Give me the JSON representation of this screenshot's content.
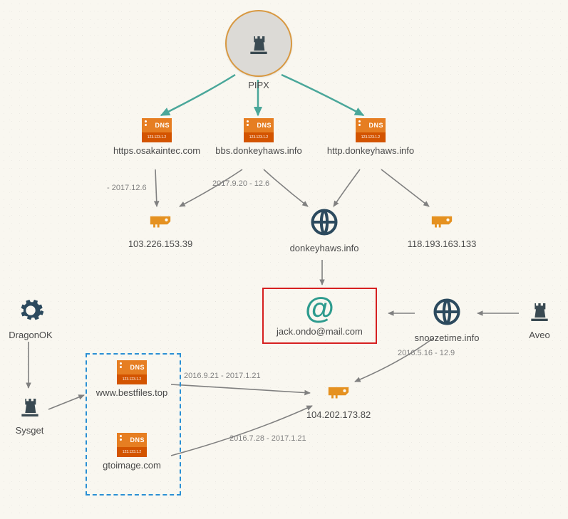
{
  "root": {
    "label": "PIPX"
  },
  "dns_nodes": {
    "osaka": {
      "label": "https.osakaintec.com"
    },
    "bbs": {
      "label": "bbs.donkeyhaws.info"
    },
    "http": {
      "label": "http.donkeyhaws.info"
    },
    "bestfiles": {
      "label": "www.bestfiles.top"
    },
    "gtoimage": {
      "label": "gtoimage.com"
    }
  },
  "ip_nodes": {
    "ip1": {
      "label": "103.226.153.39"
    },
    "ip2": {
      "label": "118.193.163.133"
    },
    "ip3": {
      "label": "104.202.173.82"
    }
  },
  "domain_nodes": {
    "donkey": {
      "label": "donkeyhaws.info"
    },
    "snooze": {
      "label": "snoozetime.info"
    }
  },
  "email": {
    "label": "jack.ondo@mail.com"
  },
  "actors": {
    "dragonok": {
      "label": "DragonOK"
    },
    "sysget": {
      "label": "Sysget"
    },
    "aveo": {
      "label": "Aveo"
    }
  },
  "edge_labels": {
    "e_osaka_ip1": "- 2017.12.6",
    "e_bbs_nodes": "2017.9.20 - 12.6",
    "e_snooze_ip3": "2016.5.16 - 12.9",
    "e_bestfiles_ip3": "2016.9.21 - 2017.1.21",
    "e_gtoimage_ip3": "2016.7.28 - 2017.1.21"
  },
  "icons": {
    "dns_tag": "DNS",
    "dns_sub": "123.123.1.2"
  }
}
